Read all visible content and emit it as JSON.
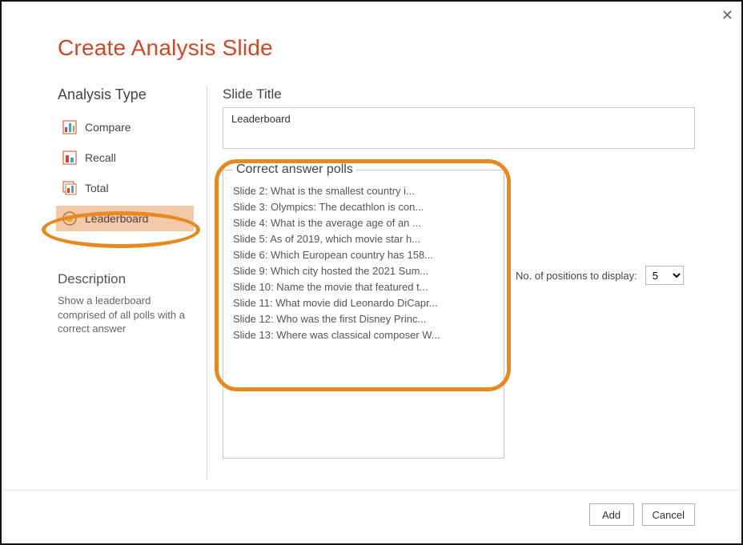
{
  "dialog": {
    "title": "Create Analysis Slide"
  },
  "sidebar": {
    "heading": "Analysis Type",
    "items": [
      {
        "label": "Compare",
        "icon": "compare"
      },
      {
        "label": "Recall",
        "icon": "recall"
      },
      {
        "label": "Total",
        "icon": "total"
      },
      {
        "label": "Leaderboard",
        "icon": "leaderboard"
      }
    ],
    "selected_index": 3,
    "description_heading": "Description",
    "description_text": "Show a leaderboard comprised of all polls with a correct answer"
  },
  "main": {
    "title_label": "Slide Title",
    "title_value": "Leaderboard",
    "polls_legend": "Correct answer polls",
    "polls": [
      "Slide 2: What is the smallest country i...",
      "Slide 3: Olympics: The decathlon is con...",
      "Slide 4: What is the average age of an ...",
      "Slide 5: As of 2019, which movie star h...",
      "Slide 6: Which European country has 158...",
      "Slide 9: Which city hosted the 2021 Sum...",
      "Slide 10: Name the movie that featured t...",
      "Slide 11: What movie did Leonardo DiCapr...",
      "Slide 12: Who was the first Disney Princ...",
      "Slide 13: Where was classical composer W..."
    ],
    "positions_label": "No. of positions to display:",
    "positions_value": "5"
  },
  "footer": {
    "add_label": "Add",
    "cancel_label": "Cancel"
  },
  "colors": {
    "accent": "#d24726",
    "highlight": "#e68a1f",
    "selected_bg": "#f3c9a8"
  }
}
